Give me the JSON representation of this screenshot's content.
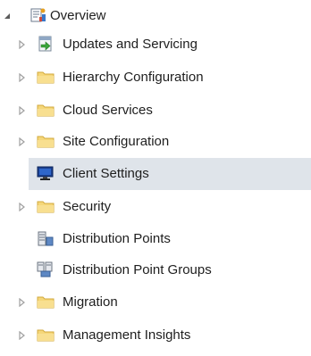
{
  "tree": {
    "root": {
      "label": "Overview",
      "icon": "overview-icon",
      "expanded": true
    },
    "items": [
      {
        "label": "Updates and Servicing",
        "icon": "updates-icon",
        "expandable": true
      },
      {
        "label": "Hierarchy Configuration",
        "icon": "folder-icon",
        "expandable": true
      },
      {
        "label": "Cloud Services",
        "icon": "folder-icon",
        "expandable": true
      },
      {
        "label": "Site Configuration",
        "icon": "folder-icon",
        "expandable": true
      },
      {
        "label": "Client Settings",
        "icon": "monitor-icon",
        "expandable": false,
        "selected": true
      },
      {
        "label": "Security",
        "icon": "folder-icon",
        "expandable": true
      },
      {
        "label": "Distribution Points",
        "icon": "distribution-point-icon",
        "expandable": false
      },
      {
        "label": "Distribution Point Groups",
        "icon": "distribution-point-groups-icon",
        "expandable": false
      },
      {
        "label": "Migration",
        "icon": "folder-icon",
        "expandable": true
      },
      {
        "label": "Management Insights",
        "icon": "folder-icon",
        "expandable": true
      }
    ]
  },
  "colors": {
    "selection": "#dde3ea",
    "folder": "#f2d675",
    "arrow": "#a0a0a0",
    "text": "#1e1e1e"
  }
}
